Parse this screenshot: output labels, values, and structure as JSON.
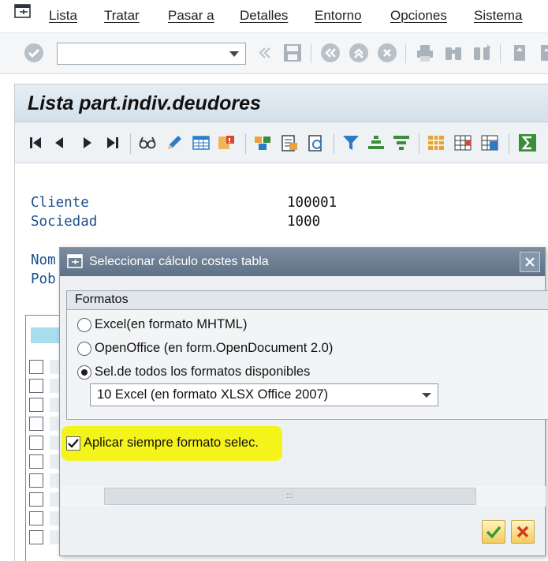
{
  "menu": {
    "items": [
      "Lista",
      "Tratar",
      "Pasar a",
      "Detalles",
      "Entorno",
      "Opciones",
      "Sistema"
    ]
  },
  "toolbar": {
    "command_field_value": "",
    "icons": [
      "enter-icon",
      "save-icon",
      "back-icon",
      "exit-icon",
      "cancel-icon",
      "print-icon",
      "find-icon",
      "find-next-icon",
      "first-page-icon",
      "previous-page-icon"
    ]
  },
  "screen": {
    "title": "Lista part.indiv.deudores",
    "app_toolbar_icons": [
      "first-icon",
      "previous-icon",
      "next-icon",
      "last-icon",
      "display-icon",
      "edit-icon",
      "select-layout-icon",
      "change-layout-icon",
      "totals-icon",
      "details-icon",
      "zoom-icon",
      "filter-icon",
      "sort-ascending-icon",
      "sort-descending-icon",
      "layout-icon",
      "column-icon",
      "export-icon",
      "sum-icon"
    ],
    "fields": [
      {
        "label": "Cliente",
        "value": "100001"
      },
      {
        "label": "Sociedad",
        "value": "1000"
      },
      {
        "label": "Nom",
        "value": ""
      },
      {
        "label": "Pob",
        "value": ""
      }
    ]
  },
  "dialog": {
    "title": "Seleccionar cálculo costes tabla",
    "group_title": "Formatos",
    "options": [
      {
        "label": "Excel(en formato MHTML)",
        "selected": false
      },
      {
        "label": "OpenOffice (en form.OpenDocument 2.0)",
        "selected": false
      },
      {
        "label": "Sel.de todos los formatos disponibles",
        "selected": true
      }
    ],
    "format_dropdown": {
      "value": "10 Excel (en formato XLSX Office 2007)"
    },
    "always_apply": {
      "label": "Aplicar siempre formato selec.",
      "checked": true
    },
    "scroll_grip": ":::",
    "highlight_color": "#f4f41a"
  }
}
